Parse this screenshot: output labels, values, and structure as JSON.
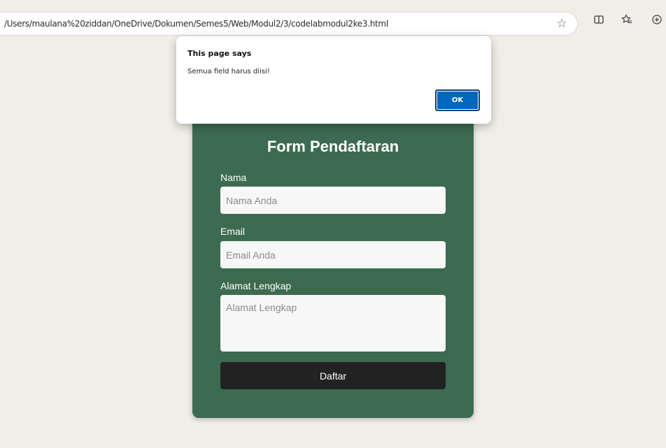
{
  "browser": {
    "url": "/Users/maulana%20ziddan/OneDrive/Dokumen/Semes5/Web/Modul2/3/codelabmodul2ke3.html",
    "icons": [
      "favorite-star-icon",
      "split-screen-icon",
      "favorites-icon",
      "extensions-icon"
    ]
  },
  "dialog": {
    "title": "This page says",
    "message": "Semua field harus diisi!",
    "ok_label": "OK"
  },
  "form": {
    "title": "Form Pendaftaran",
    "nama_label": "Nama",
    "nama_placeholder": "Nama Anda",
    "email_label": "Email",
    "email_placeholder": "Email Anda",
    "alamat_label": "Alamat Lengkap",
    "alamat_placeholder": "Alamat Lengkap",
    "submit_label": "Daftar"
  },
  "colors": {
    "page_bg": "#f1eee8",
    "card_bg": "#3d6b50",
    "button_bg": "#222222",
    "dialog_ok": "#0067c0"
  }
}
